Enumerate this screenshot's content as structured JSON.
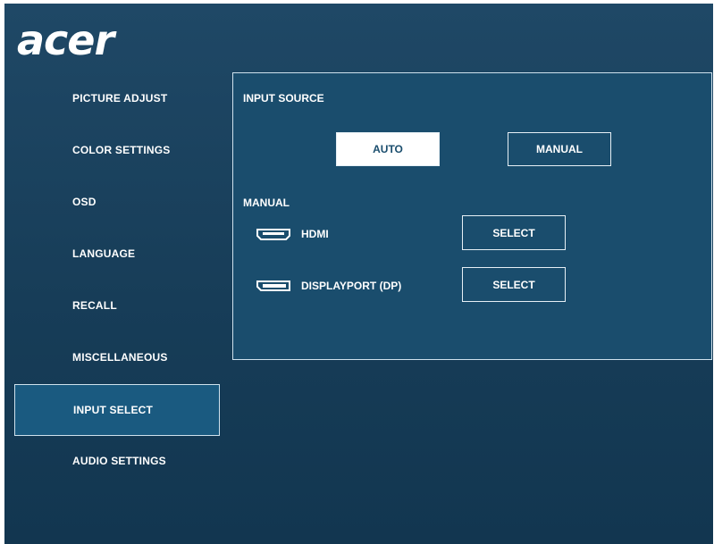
{
  "brand": {
    "logo_text": "acer"
  },
  "menu": {
    "items": [
      {
        "label": "PICTURE ADJUST"
      },
      {
        "label": "COLOR SETTINGS"
      },
      {
        "label": "OSD"
      },
      {
        "label": "LANGUAGE"
      },
      {
        "label": "RECALL"
      },
      {
        "label": "MISCELLANEOUS"
      },
      {
        "label": "INPUT SELECT",
        "active": true
      },
      {
        "label": "AUDIO SETTINGS"
      }
    ]
  },
  "panel": {
    "input_source_heading": "INPUT SOURCE",
    "auto_label": "AUTO",
    "manual_label": "MANUAL",
    "selected_mode": "AUTO",
    "manual_heading": "MANUAL",
    "sources": [
      {
        "name": "HDMI",
        "icon": "hdmi-port-icon",
        "button_label": "SELECT"
      },
      {
        "name": "DISPLAYPORT (DP)",
        "icon": "displayport-icon",
        "button_label": "SELECT"
      }
    ]
  },
  "colors": {
    "background": "#173d58",
    "panel": "#1a4d6d",
    "active_item": "#1a5a80",
    "border": "#cfe2ee"
  }
}
